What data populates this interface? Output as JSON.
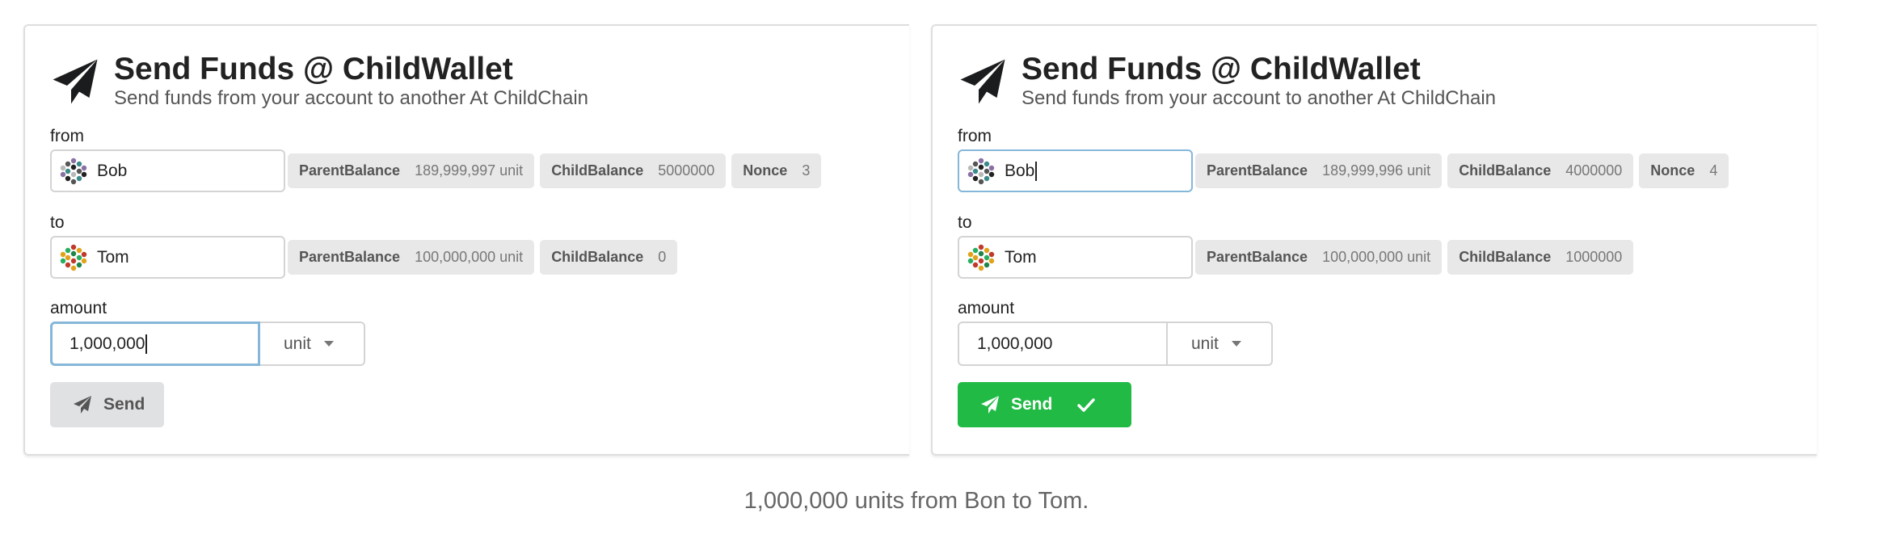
{
  "colors": {
    "success": "#21ba45",
    "focus_border": "#85b7d9",
    "chip_bg": "#e8e8e8"
  },
  "panels": [
    {
      "title": "Send Funds @ ChildWallet",
      "subtitle": "Send funds from your account to another At ChildChain",
      "from_label": "from",
      "from_value": "Bob",
      "from_chips": [
        {
          "key": "ParentBalance",
          "value": "189,999,997 unit"
        },
        {
          "key": "ChildBalance",
          "value": "5000000"
        },
        {
          "key": "Nonce",
          "value": "3"
        }
      ],
      "to_label": "to",
      "to_value": "Tom",
      "to_chips": [
        {
          "key": "ParentBalance",
          "value": "100,000,000 unit"
        },
        {
          "key": "ChildBalance",
          "value": "0"
        }
      ],
      "amount_label": "amount",
      "amount_value": "1,000,000",
      "unit_value": "unit",
      "send_label": "Send",
      "send_state": "idle"
    },
    {
      "title": "Send Funds @ ChildWallet",
      "subtitle": "Send funds from your account to another At ChildChain",
      "from_label": "from",
      "from_value": "Bob",
      "from_chips": [
        {
          "key": "ParentBalance",
          "value": "189,999,996 unit"
        },
        {
          "key": "ChildBalance",
          "value": "4000000"
        },
        {
          "key": "Nonce",
          "value": "4"
        }
      ],
      "to_label": "to",
      "to_value": "Tom",
      "to_chips": [
        {
          "key": "ParentBalance",
          "value": "100,000,000 unit"
        },
        {
          "key": "ChildBalance",
          "value": "1000000"
        }
      ],
      "amount_label": "amount",
      "amount_value": "1,000,000",
      "unit_value": "unit",
      "send_label": "Send",
      "send_state": "success"
    }
  ],
  "caption": "1,000,000 units from Bon to Tom."
}
